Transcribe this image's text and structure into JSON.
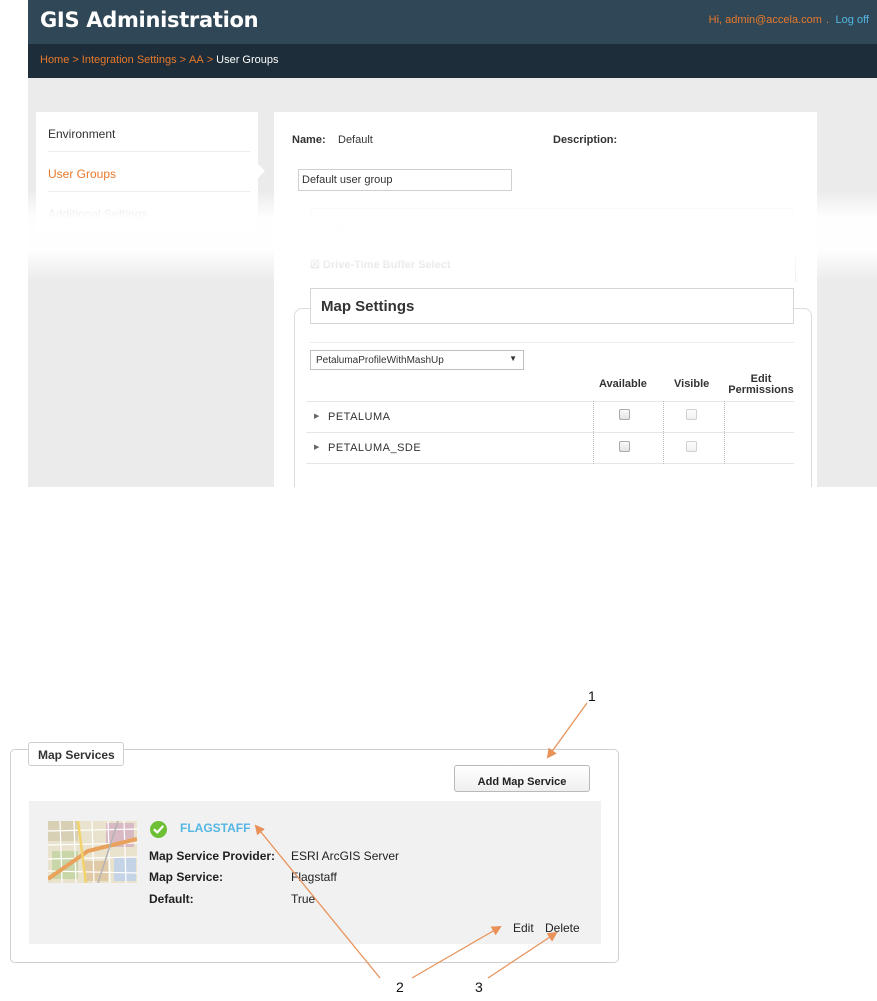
{
  "header": {
    "title": "GIS Administration",
    "greeting": "Hi, admin@accela.com",
    "separator": ".",
    "logoff": "Log off"
  },
  "breadcrumb": [
    "Home",
    "Integration Settings",
    "AA",
    "User Groups"
  ],
  "breadcrumb_sep": ">",
  "sidebar": {
    "items": [
      {
        "label": "Environment"
      },
      {
        "label": "User Groups"
      },
      {
        "label": "Additional Settings"
      }
    ]
  },
  "group": {
    "name_label": "Name:",
    "name_value": "Default",
    "description_label": "Description:",
    "description_value": "Default user group"
  },
  "map_commands": {
    "title": "Map Commands",
    "item": "Drive-Time Buffer Select"
  },
  "map_settings": {
    "title": "Map Settings",
    "profile": "PetalumaProfileWithMashUp",
    "columns": {
      "available": "Available",
      "visible": "Visible",
      "edit_line1": "Edit",
      "edit_line2": "Permissions"
    },
    "layers": [
      {
        "name": "PETALUMA",
        "available": false,
        "visible": false
      },
      {
        "name": "PETALUMA_SDE",
        "available": false,
        "visible": false
      }
    ]
  },
  "map_services": {
    "legend": "Map Services",
    "add_button": "Add Map Service",
    "service": {
      "name": "FLAGSTAFF",
      "provider_label": "Map Service Provider:",
      "provider_value": "ESRI ArcGIS Server",
      "service_label": "Map Service:",
      "service_value": "Flagstaff",
      "default_label": "Default:",
      "default_value": "True"
    },
    "edit": "Edit",
    "delete": "Delete"
  },
  "callouts": [
    "1",
    "2",
    "3"
  ],
  "colors": {
    "header_bg": "#2f4756",
    "breadcrumb_bg": "#1d2d39",
    "accent_orange": "#e8792b",
    "link_blue": "#55b6e3",
    "check_green": "#6dbf34",
    "arrow": "#e8925a"
  },
  "icons": {
    "expand": "triangle-right-icon",
    "dropdown": "caret-down-icon",
    "status": "check-circle-icon",
    "thumbnail": "map-thumbnail-icon"
  }
}
